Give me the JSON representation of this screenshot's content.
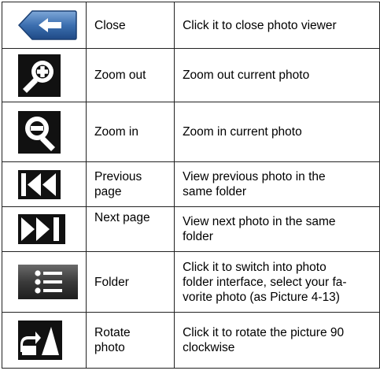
{
  "rows": [
    {
      "icon": "back-arrow-icon",
      "name": "Close",
      "desc": "Click it to close photo viewer"
    },
    {
      "icon": "zoom-plus-icon",
      "name": "Zoom out",
      "desc": "Zoom out current photo"
    },
    {
      "icon": "zoom-minus-icon",
      "name": "Zoom in",
      "desc": "Zoom in current photo"
    },
    {
      "icon": "previous-page-icon",
      "name": "Previous\npage",
      "desc": "View previous photo in the\nsame folder"
    },
    {
      "icon": "next-page-icon",
      "name": "Next  page",
      "desc": "View next photo in the same\nfolder"
    },
    {
      "icon": "folder-list-icon",
      "name": "Folder",
      "desc": "Click it to switch into photo\nfolder interface, select your fa-\nvorite photo (as Picture 4-13)"
    },
    {
      "icon": "rotate-photo-icon",
      "name": "Rotate\nphoto",
      "desc": "Click it to rotate the picture 90\nclockwise"
    }
  ],
  "colors": {
    "close_button_blue": "#3c6fb0",
    "folder_button_dark": "#333333"
  }
}
